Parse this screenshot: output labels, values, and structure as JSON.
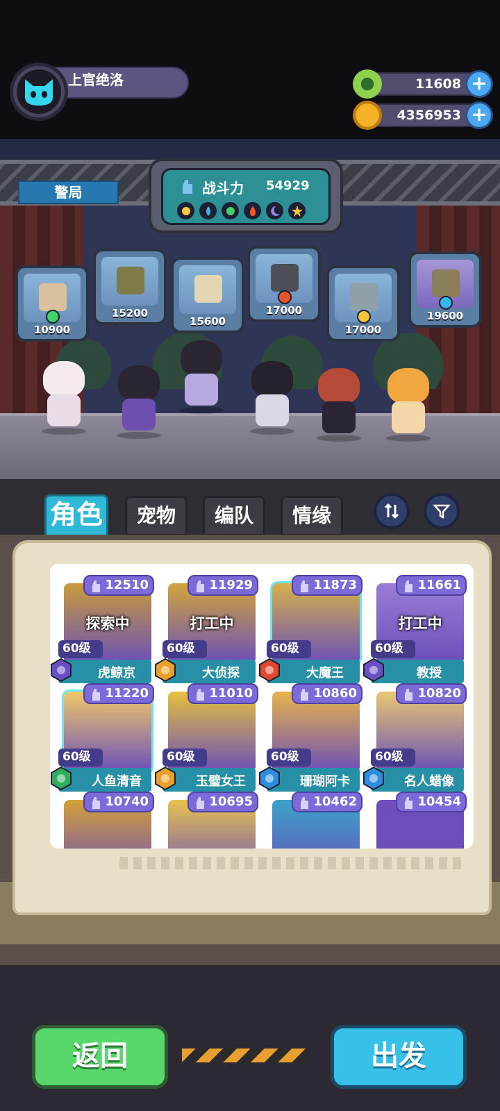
{
  "player": {
    "name": "上官绝洛",
    "avatar_icon": "cat-face-icon"
  },
  "currencies": [
    {
      "name": "green-token",
      "value": "11608",
      "color": "#8fd14f"
    },
    {
      "name": "gold-planet",
      "value": "4356953",
      "color": "#f5b328"
    }
  ],
  "location_sign": "警局",
  "power": {
    "label": "战斗力",
    "value": "54929"
  },
  "elements": [
    "sun-icon",
    "water-drop-icon",
    "leaf-icon",
    "fire-icon",
    "moon-icon",
    "star-icon"
  ],
  "trophies": [
    {
      "value": "10900",
      "gem_color": "#3fd46a"
    },
    {
      "value": "15200",
      "gem_color": ""
    },
    {
      "value": "15600",
      "gem_color": ""
    },
    {
      "value": "17000",
      "gem_color": "#e8542e"
    },
    {
      "value": "17000",
      "gem_color": "#f2c43a"
    },
    {
      "value": "19600",
      "gem_color": "#36b8e6"
    }
  ],
  "tabs": [
    {
      "label": "角色",
      "active": true
    },
    {
      "label": "宠物",
      "active": false
    },
    {
      "label": "编队",
      "active": false
    },
    {
      "label": "情缘",
      "active": false
    }
  ],
  "cards": [
    {
      "power": "12510",
      "status": "探索中",
      "level": "60级",
      "name": "虎鲸京",
      "badge_color": "#6b4fc6"
    },
    {
      "power": "11929",
      "status": "打工中",
      "level": "60级",
      "name": "大侦探",
      "badge_color": "#e9a12b"
    },
    {
      "power": "11873",
      "status": "",
      "level": "60级",
      "name": "大魔王",
      "badge_color": "#e2482e"
    },
    {
      "power": "11661",
      "status": "打工中",
      "level": "60级",
      "name": "教授",
      "badge_color": "#6b4fc6"
    },
    {
      "power": "11220",
      "status": "",
      "level": "60级",
      "name": "人鱼清音",
      "badge_color": "#2fae5e"
    },
    {
      "power": "11010",
      "status": "",
      "level": "60级",
      "name": "玉璧女王",
      "badge_color": "#e9a12b"
    },
    {
      "power": "10860",
      "status": "",
      "level": "60级",
      "name": "珊瑚阿卡",
      "badge_color": "#2f8de0"
    },
    {
      "power": "10820",
      "status": "",
      "level": "60级",
      "name": "名人蜡像",
      "badge_color": "#2f8de0"
    },
    {
      "power": "10740",
      "status": "",
      "level": "",
      "name": "",
      "badge_color": ""
    },
    {
      "power": "10695",
      "status": "",
      "level": "",
      "name": "",
      "badge_color": ""
    },
    {
      "power": "10462",
      "status": "",
      "level": "",
      "name": "",
      "badge_color": ""
    },
    {
      "power": "10454",
      "status": "",
      "level": "",
      "name": "",
      "badge_color": ""
    }
  ],
  "buttons": {
    "back": "返回",
    "go": "出发"
  }
}
